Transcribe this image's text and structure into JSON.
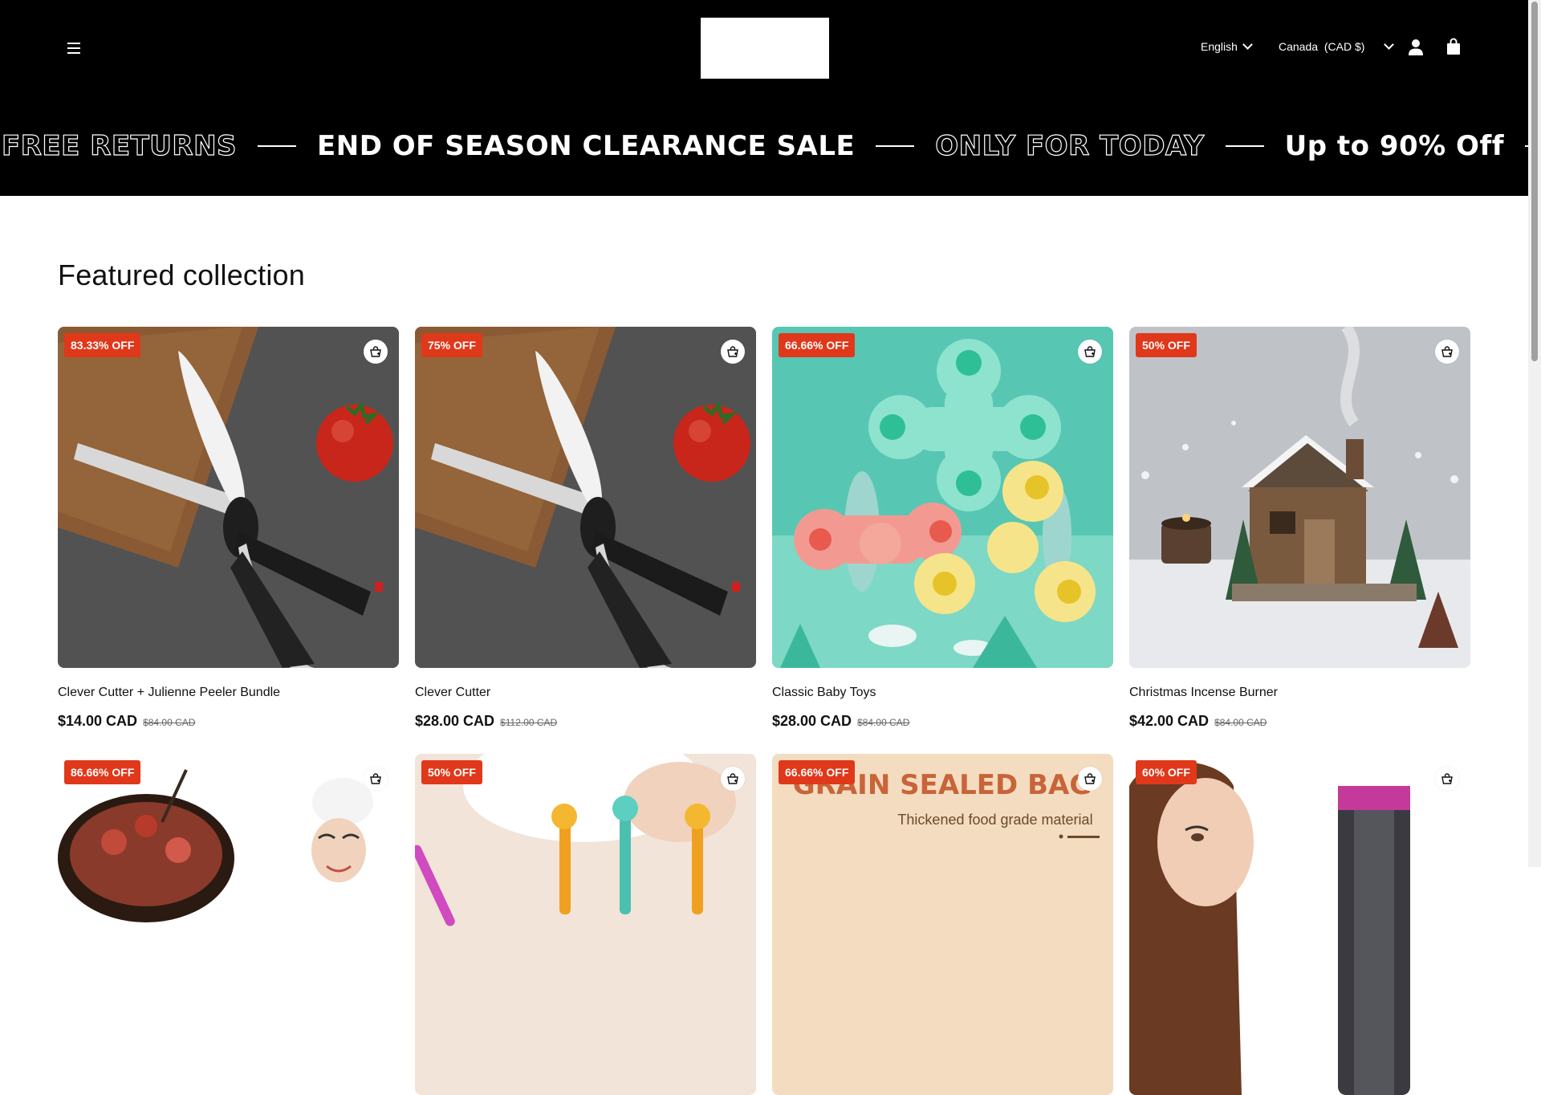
{
  "header": {
    "language": "English",
    "country": "Canada",
    "currency": "(CAD $)"
  },
  "marquee": [
    {
      "text": "FREE RETURNS",
      "style": "outline"
    },
    {
      "text": "END OF SEASON CLEARANCE SALE",
      "style": "solid"
    },
    {
      "text": "ONLY FOR TODAY",
      "style": "outline"
    },
    {
      "text": "Up to 90% Off",
      "style": "solid"
    },
    {
      "text": "FREE RETURNS",
      "style": "outline"
    }
  ],
  "section": {
    "title": "Featured collection"
  },
  "products": [
    {
      "badge": "83.33% OFF",
      "title": "Clever Cutter + Julienne Peeler Bundle",
      "price": "$14.00 CAD",
      "compare": "$84.00 CAD",
      "image": "scissors-cutter"
    },
    {
      "badge": "75% OFF",
      "title": "Clever Cutter",
      "price": "$28.00 CAD",
      "compare": "$112.00 CAD",
      "image": "scissors-cutter"
    },
    {
      "badge": "66.66% OFF",
      "title": "Classic Baby Toys",
      "price": "$28.00 CAD",
      "compare": "$84.00 CAD",
      "image": "spinner-toys"
    },
    {
      "badge": "50% OFF",
      "title": "Christmas Incense Burner",
      "price": "$42.00 CAD",
      "compare": "$84.00 CAD",
      "image": "cabin-incense"
    },
    {
      "badge": "86.66% OFF",
      "title": "",
      "price": "",
      "compare": "",
      "image": "chef-dish"
    },
    {
      "badge": "50% OFF",
      "title": "",
      "price": "",
      "compare": "",
      "image": "giraffe-toys"
    },
    {
      "badge": "66.66% OFF",
      "title": "",
      "price": "",
      "compare": "",
      "image": "grain-bag",
      "image_text": [
        "GRAIN SEALED BAG",
        "Thickened food grade material"
      ]
    },
    {
      "badge": "60% OFF",
      "title": "",
      "price": "",
      "compare": "",
      "image": "hair-curler"
    }
  ],
  "colors": {
    "badge": "#e0381a",
    "header_bg": "#000000"
  }
}
